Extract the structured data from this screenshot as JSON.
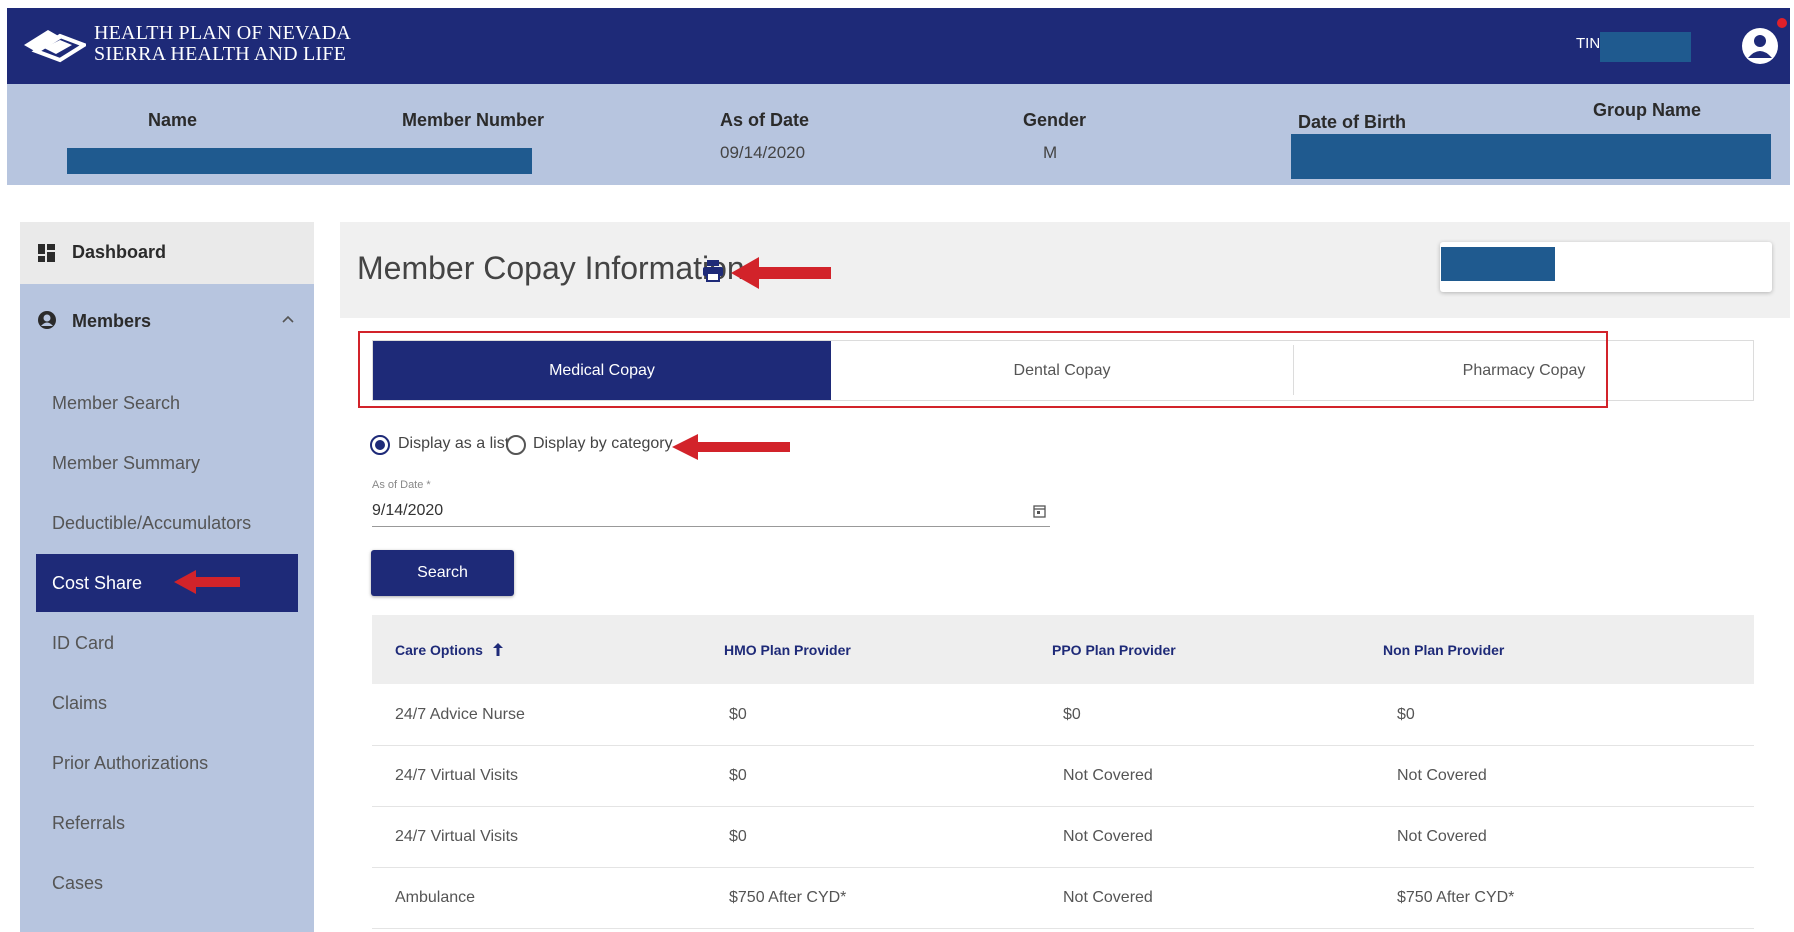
{
  "brand": {
    "line1": "HEALTH PLAN OF NEVADA",
    "line2": "SIERRA HEALTH AND LIFE"
  },
  "topbar": {
    "tin_label": "TIN:"
  },
  "member_header": {
    "name_label": "Name",
    "member_number_label": "Member Number",
    "as_of_date_label": "As of Date",
    "as_of_date_value": "09/14/2020",
    "gender_label": "Gender",
    "gender_value": "M",
    "dob_label": "Date of Birth",
    "group_name_label": "Group Name"
  },
  "sidebar": {
    "dashboard_label": "Dashboard",
    "members_label": "Members",
    "items": [
      {
        "label": "Member Search"
      },
      {
        "label": "Member Summary"
      },
      {
        "label": "Deductible/Accumulators"
      },
      {
        "label": "Cost Share",
        "active": true
      },
      {
        "label": "ID Card"
      },
      {
        "label": "Claims"
      },
      {
        "label": "Prior Authorizations"
      },
      {
        "label": "Referrals"
      },
      {
        "label": "Cases"
      }
    ]
  },
  "main": {
    "title": "Member Copay Information",
    "tabs": [
      {
        "label": "Medical Copay",
        "active": true
      },
      {
        "label": "Dental Copay"
      },
      {
        "label": "Pharmacy Copay"
      }
    ],
    "display_options": [
      {
        "label": "Display as a list",
        "checked": true
      },
      {
        "label": "Display by category",
        "checked": false
      }
    ],
    "date_field": {
      "label": "As of Date *",
      "value": "9/14/2020"
    },
    "search_label": "Search",
    "table": {
      "headers": [
        "Care Options",
        "HMO Plan Provider",
        "PPO Plan Provider",
        "Non Plan Provider"
      ],
      "rows": [
        [
          "24/7 Advice Nurse",
          "$0",
          "$0",
          "$0"
        ],
        [
          "24/7 Virtual Visits",
          "$0",
          "Not Covered",
          "Not Covered"
        ],
        [
          "24/7 Virtual Visits",
          "$0",
          "Not Covered",
          "Not Covered"
        ],
        [
          "Ambulance",
          "$750 After CYD*",
          "Not Covered",
          "$750 After CYD*"
        ]
      ]
    }
  },
  "colors": {
    "navy": "#1e2a78",
    "light_blue": "#b7c5df",
    "redacted": "#1f5a8f",
    "annotation_red": "#d2232a"
  },
  "icons": [
    "logo-icon",
    "user-icon",
    "dashboard-icon",
    "members-icon",
    "chevron-up-icon",
    "print-icon",
    "calendar-icon",
    "sort-up-icon",
    "annotation-arrow"
  ]
}
